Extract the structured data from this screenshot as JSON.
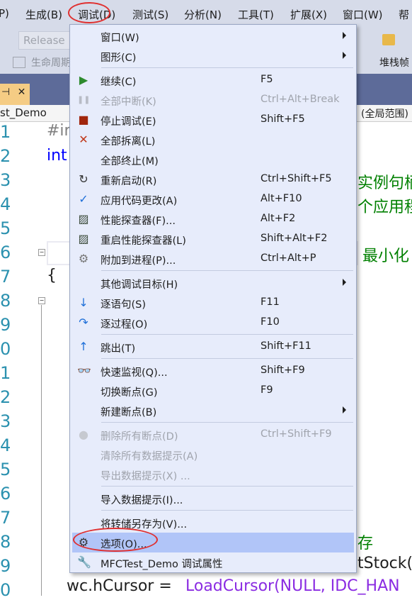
{
  "menubar": {
    "items": [
      "P)",
      "生成(B)",
      "调试(D)",
      "测试(S)",
      "分析(N)",
      "工具(T)",
      "扩展(X)",
      "窗口(W)",
      "帮"
    ]
  },
  "toolbar": {
    "config": "Release",
    "lifecycle": "生命周期",
    "stackframe": "堆栈帧"
  },
  "tab": {
    "pin": "⊣",
    "close": "✕"
  },
  "nav": {
    "project": "st_Demo",
    "scope": "(全局范围)"
  },
  "editor": {
    "line_numbers": [
      "1",
      "2",
      "3",
      "4",
      "5",
      "6",
      "7",
      "8",
      "9",
      "0",
      "1",
      "2",
      "3",
      "4",
      "5",
      "6",
      "7",
      "8",
      "9",
      "0"
    ],
    "snippets": {
      "l1": "#ir",
      "l2": "int",
      "l3": "实例句柄",
      "l4": "个应用程",
      "l6": "最小化",
      "l7": "{",
      "l18": "存",
      "l19": "tStock(",
      "l20a": "wc.hCursor = ",
      "l20b": "LoadCursor(NULL, IDC_HAN"
    }
  },
  "debug_menu": {
    "items": [
      {
        "label": "窗口(W)",
        "submenu": true
      },
      {
        "label": "图形(C)",
        "submenu": true
      },
      {
        "label": "继续(C)",
        "shortcut": "F5",
        "icon": "play-icon"
      },
      {
        "label": "全部中断(K)",
        "shortcut": "Ctrl+Alt+Break",
        "icon": "pause-icon",
        "disabled": true
      },
      {
        "label": "停止调试(E)",
        "shortcut": "Shift+F5",
        "icon": "stop-icon"
      },
      {
        "label": "全部拆离(L)",
        "icon": "detach-icon"
      },
      {
        "label": "全部终止(M)"
      },
      {
        "label": "重新启动(R)",
        "shortcut": "Ctrl+Shift+F5",
        "icon": "restart-icon"
      },
      {
        "label": "应用代码更改(A)",
        "shortcut": "Alt+F10",
        "icon": "apply-changes-icon"
      },
      {
        "label": "性能探查器(F)...",
        "shortcut": "Alt+F2",
        "icon": "profiler-icon"
      },
      {
        "label": "重启性能探查器(L)",
        "shortcut": "Shift+Alt+F2",
        "icon": "profiler-icon"
      },
      {
        "label": "附加到进程(P)...",
        "shortcut": "Ctrl+Alt+P",
        "icon": "gears-icon"
      },
      {
        "label": "其他调试目标(H)",
        "submenu": true
      },
      {
        "label": "逐语句(S)",
        "shortcut": "F11",
        "icon": "step-into-icon"
      },
      {
        "label": "逐过程(O)",
        "shortcut": "F10",
        "icon": "step-over-icon"
      },
      {
        "label": "跳出(T)",
        "shortcut": "Shift+F11",
        "icon": "step-out-icon"
      },
      {
        "label": "快速监视(Q)...",
        "shortcut": "Shift+F9",
        "icon": "glasses-icon"
      },
      {
        "label": "切换断点(G)",
        "shortcut": "F9"
      },
      {
        "label": "新建断点(B)",
        "submenu": true
      },
      {
        "label": "删除所有断点(D)",
        "shortcut": "Ctrl+Shift+F9",
        "icon": "delete-breakpoints-icon",
        "disabled": true
      },
      {
        "label": "清除所有数据提示(A)",
        "disabled": true
      },
      {
        "label": "导出数据提示(X) ...",
        "disabled": true
      },
      {
        "label": "导入数据提示(I)..."
      },
      {
        "label": "将转储另存为(V)..."
      },
      {
        "label": "选项(O)...",
        "icon": "gear-icon",
        "highlighted": true
      },
      {
        "label": "MFCTest_Demo 调试属性",
        "icon": "wrench-icon"
      }
    ]
  },
  "colors": {
    "accent_ring": "#e03030",
    "highlight": "#b1c5f8",
    "menu_bg": "#e7ecfb"
  }
}
